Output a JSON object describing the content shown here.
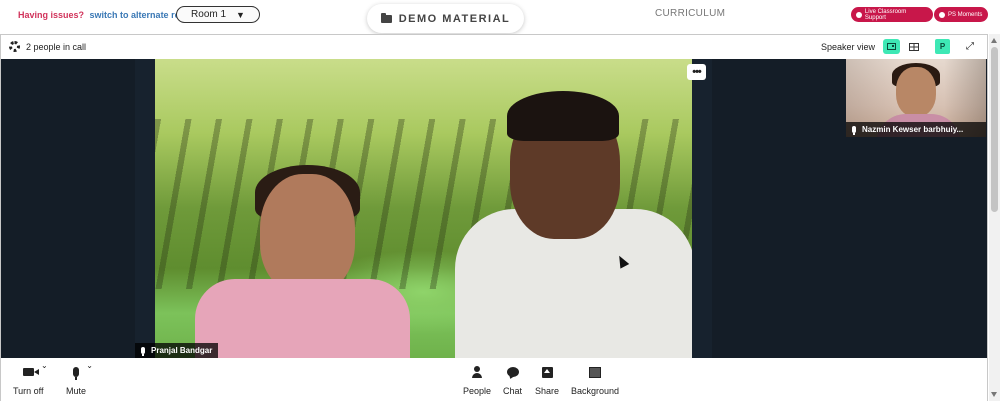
{
  "topbar": {
    "issues_text": "Having issues?",
    "alternate_link": "switch to alternate room",
    "room_value": "Room 1",
    "demo_material_label": "DEMO MATERIAL",
    "curriculum_label": "CURRICULUM",
    "support_label": "Live Classroom Support",
    "moments_label": "PS Moments"
  },
  "call": {
    "people_count": "2 people in call",
    "view_label": "Speaker view",
    "profile_initial": "P"
  },
  "participants": {
    "main_name": "Pranjal Bandgar",
    "thumb_name": "Nazmin Kewser barbhuiy..."
  },
  "toolbar": {
    "camera_label": "Turn off",
    "mute_label": "Mute",
    "people_label": "People",
    "chat_label": "Chat",
    "share_label": "Share",
    "background_label": "Background"
  },
  "colors": {
    "accent_green": "#3ee8b5",
    "brand_red": "#c8174a",
    "stage_bg": "#141d27"
  }
}
